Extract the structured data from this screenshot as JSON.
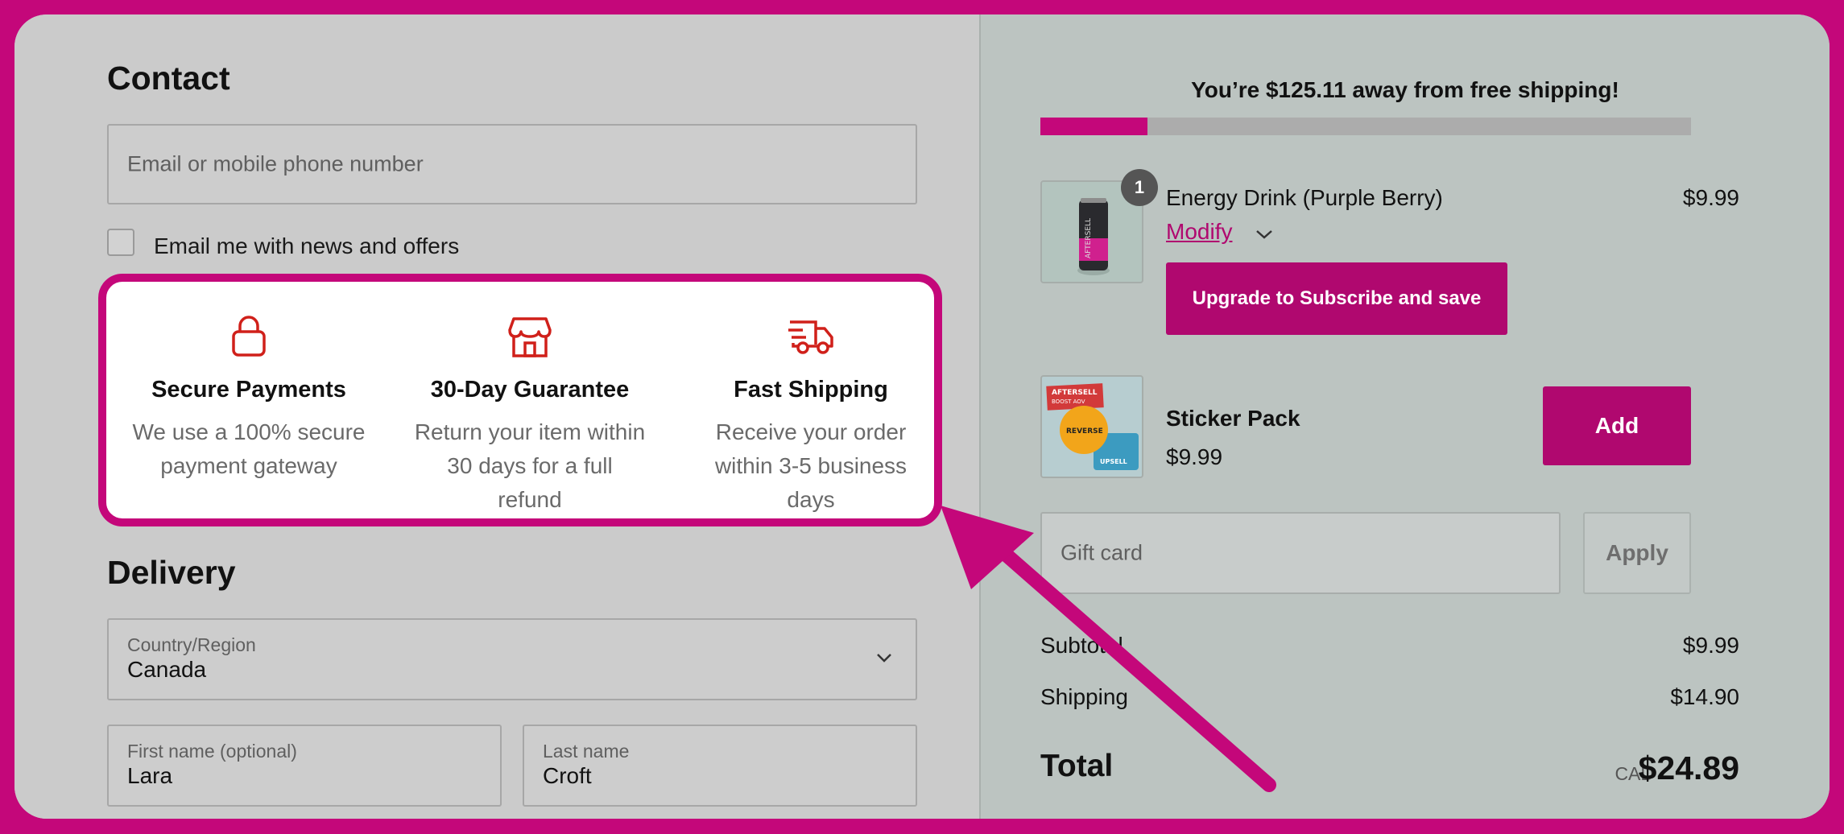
{
  "contact": {
    "heading": "Contact",
    "email_placeholder": "Email or mobile phone number",
    "newsletter_label": "Email me with news and offers",
    "newsletter_checked": false
  },
  "trust_badges": [
    {
      "icon": "lock-icon",
      "title": "Secure Payments",
      "desc_lines": [
        "We use a 100% secure",
        "payment gateway"
      ]
    },
    {
      "icon": "store-icon",
      "title": "30-Day Guarantee",
      "desc_lines": [
        "Return your item within",
        "30 days for a full",
        "refund"
      ]
    },
    {
      "icon": "delivery-truck-icon",
      "title": "Fast Shipping",
      "desc_lines": [
        "Receive your order",
        "within 3-5 business",
        "days"
      ]
    }
  ],
  "delivery": {
    "heading": "Delivery",
    "country_label": "Country/Region",
    "country_value": "Canada",
    "first_name_label": "First name (optional)",
    "first_name_value": "Lara",
    "last_name_label": "Last name",
    "last_name_value": "Croft"
  },
  "cart": {
    "free_shipping_message": "You’re $125.11 away from free shipping!",
    "free_shipping_progress": 0.165,
    "items": [
      {
        "name": "Energy Drink (Purple Berry)",
        "price": "$9.99",
        "quantity": "1",
        "modify_label": "Modify",
        "upgrade_label": "Upgrade to Subscribe and save"
      }
    ],
    "upsell": {
      "name": "Sticker Pack",
      "price": "$9.99",
      "add_label": "Add",
      "image_text": [
        "AFTERSELL",
        "BOOST AOV",
        "REVERSE",
        "UPSELL"
      ]
    },
    "gift_card_placeholder": "Gift card",
    "apply_label": "Apply",
    "subtotal_label": "Subtotal",
    "subtotal_value": "$9.99",
    "shipping_label": "Shipping",
    "shipping_value": "$14.90",
    "total_label": "Total",
    "currency": "CAD",
    "total_value": "$24.89"
  },
  "colors": {
    "accent": "#c4077a",
    "button": "#b0086f",
    "icon_red": "#d0201a"
  }
}
